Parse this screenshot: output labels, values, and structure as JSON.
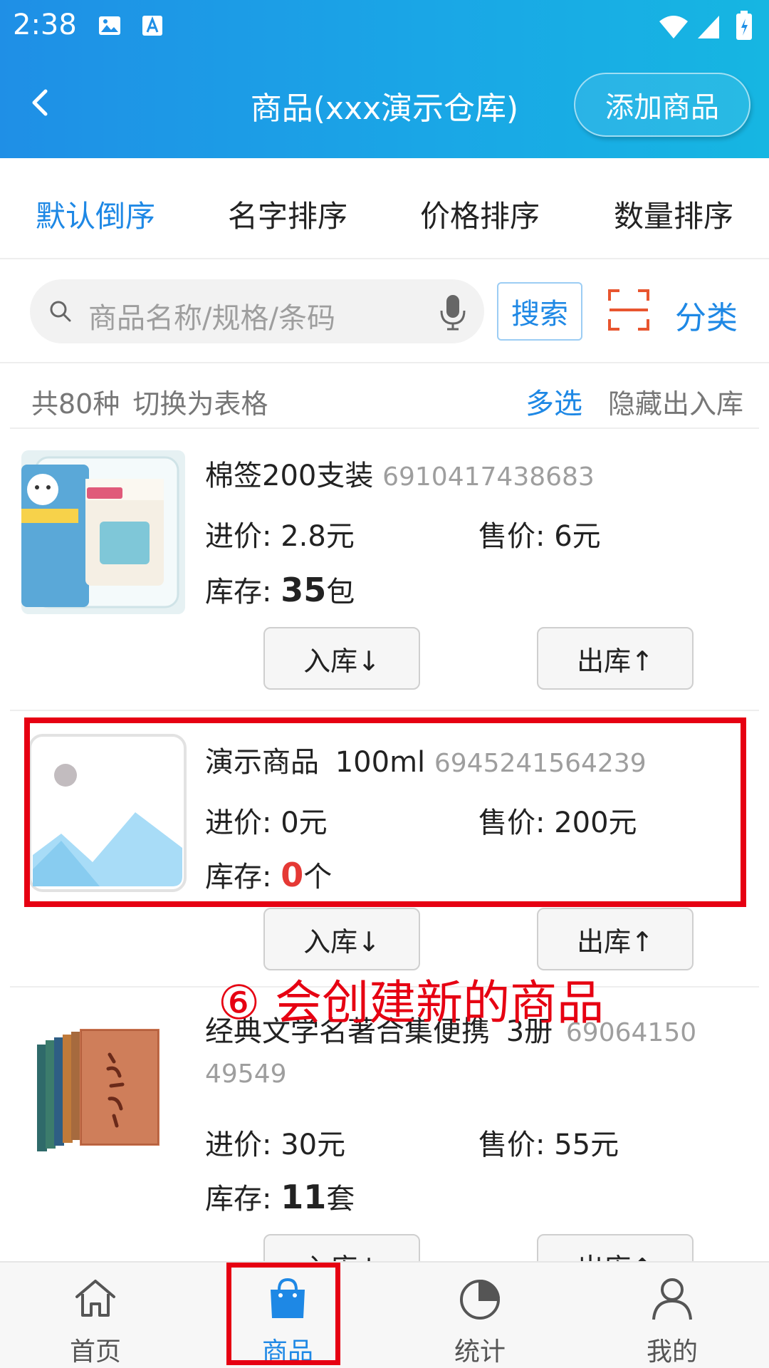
{
  "status": {
    "time": "2:38"
  },
  "header": {
    "title": "商品(xxx演示仓库)",
    "add_label": "添加商品"
  },
  "sort_tabs": [
    {
      "label": "默认倒序",
      "active": true
    },
    {
      "label": "名字排序",
      "active": false
    },
    {
      "label": "价格排序",
      "active": false
    },
    {
      "label": "数量排序",
      "active": false
    }
  ],
  "search": {
    "placeholder": "商品名称/规格/条码",
    "button": "搜索",
    "category": "分类"
  },
  "info": {
    "count_text": "共80种",
    "switch_text": "切换为表格",
    "multi_select": "多选",
    "hide_io": "隐藏出入库"
  },
  "products": [
    {
      "name": "棉签200支装",
      "barcode": "6910417438683",
      "purchase_label": "进价:",
      "purchase": "2.8元",
      "sale_label": "售价:",
      "sale": "6元",
      "stock_label": "库存:",
      "stock_num": "35",
      "stock_unit": "包",
      "in_label": "入库↓",
      "out_label": "出库↑"
    },
    {
      "name": "演示商品",
      "spec": "100ml",
      "barcode": "6945241564239",
      "purchase_label": "进价:",
      "purchase": "0元",
      "sale_label": "售价:",
      "sale": "200元",
      "stock_label": "库存:",
      "stock_num": "0",
      "stock_unit": "个",
      "in_label": "入库↓",
      "out_label": "出库↑"
    },
    {
      "name": "经典文学名著合集便携",
      "spec": "3册",
      "barcode": "6906415049549",
      "barcode_line1": "69064150",
      "barcode_line2": "49549",
      "purchase_label": "进价:",
      "purchase": "30元",
      "sale_label": "售价:",
      "sale": "55元",
      "stock_label": "库存:",
      "stock_num": "11",
      "stock_unit": "套",
      "in_label": "入库↓",
      "out_label": "出库↑"
    }
  ],
  "annotation": "⑥ 会创建新的商品",
  "bottom_nav": [
    {
      "label": "首页",
      "icon": "home-icon",
      "active": false
    },
    {
      "label": "商品",
      "icon": "shopping-bag-icon",
      "active": true
    },
    {
      "label": "统计",
      "icon": "pie-chart-icon",
      "active": false
    },
    {
      "label": "我的",
      "icon": "user-icon",
      "active": false
    }
  ],
  "colors": {
    "accent": "#1e88e5",
    "header_from": "#1f8fe6",
    "header_to": "#16b6e2",
    "highlight": "#e60012",
    "zero_stock": "#e53935"
  }
}
